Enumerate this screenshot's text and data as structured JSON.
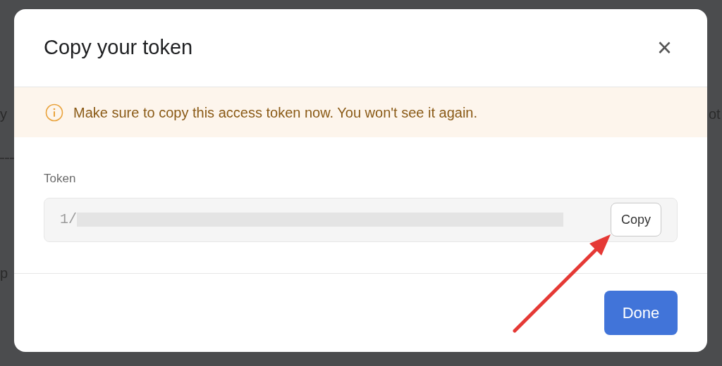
{
  "background": {
    "left_fragments": [
      "y",
      "p"
    ],
    "right_fragments": [
      "ot"
    ]
  },
  "dialog": {
    "title": "Copy your token",
    "close": "×",
    "warning": "Make sure to copy this access token now. You won't see it again.",
    "token_field": {
      "label": "Token",
      "value": "1/",
      "redacted": true
    },
    "copy_button": "Copy",
    "buttons": [
      "Done"
    ]
  },
  "annotation": {
    "kind": "arrow",
    "color": "#e53935"
  }
}
